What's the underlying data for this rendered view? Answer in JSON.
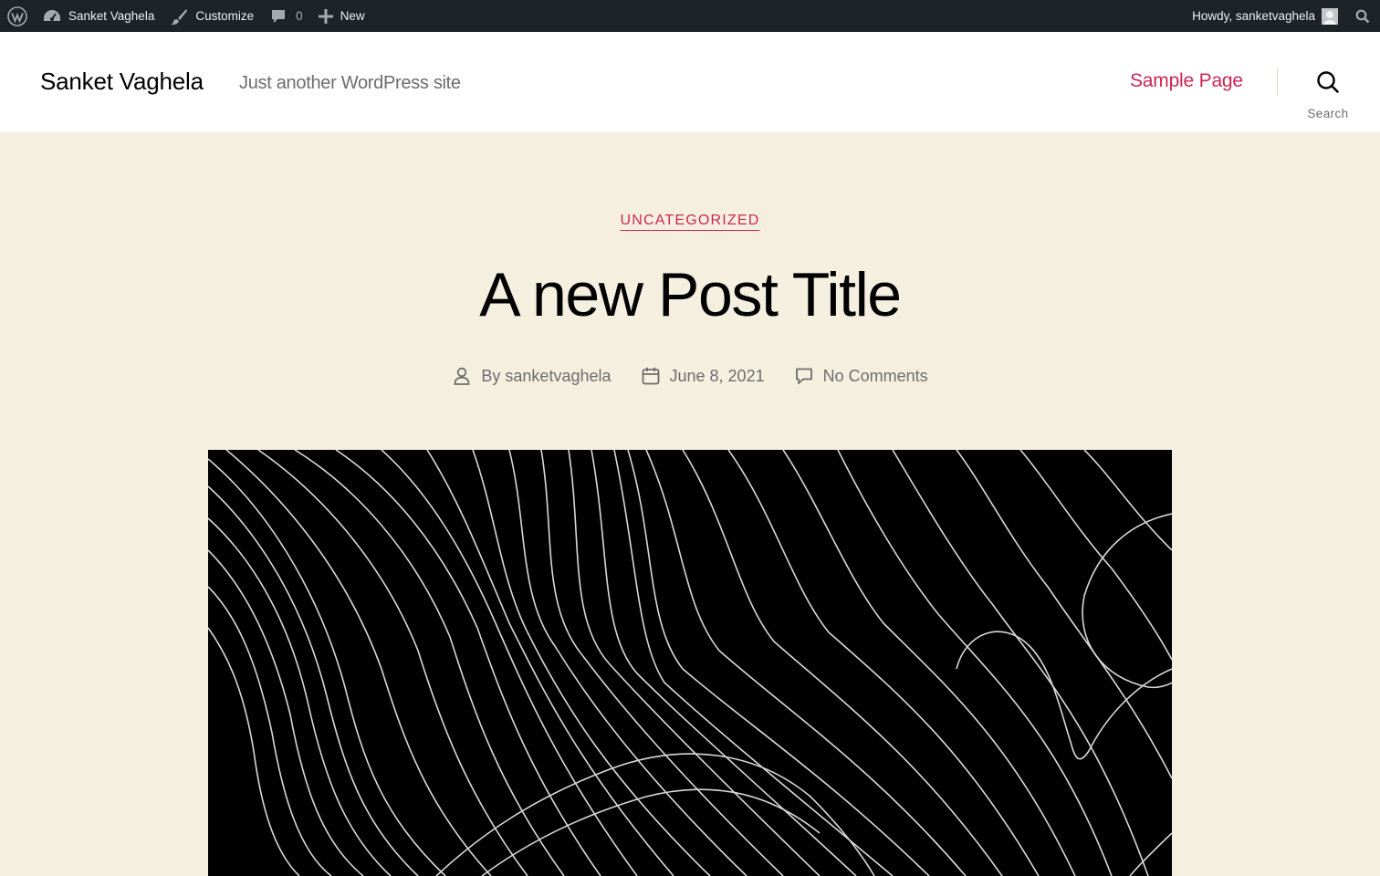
{
  "adminbar": {
    "site_name": "Sanket Vaghela",
    "customize": "Customize",
    "comments_count": "0",
    "new_label": "New",
    "howdy": "Howdy, sanketvaghela"
  },
  "header": {
    "site_title": "Sanket Vaghela",
    "tagline": "Just another WordPress site",
    "nav": [
      {
        "label": "Sample Page"
      }
    ],
    "search_label": "Search"
  },
  "post": {
    "category": "UNCATEGORIZED",
    "title": "A new Post Title",
    "author": "sanketvaghela",
    "author_prefix": "By",
    "date": "June 8, 2021",
    "comments": "No Comments"
  },
  "colors": {
    "accent": "#cd2653",
    "background": "#f5efe0",
    "adminbar": "#1d2327"
  }
}
